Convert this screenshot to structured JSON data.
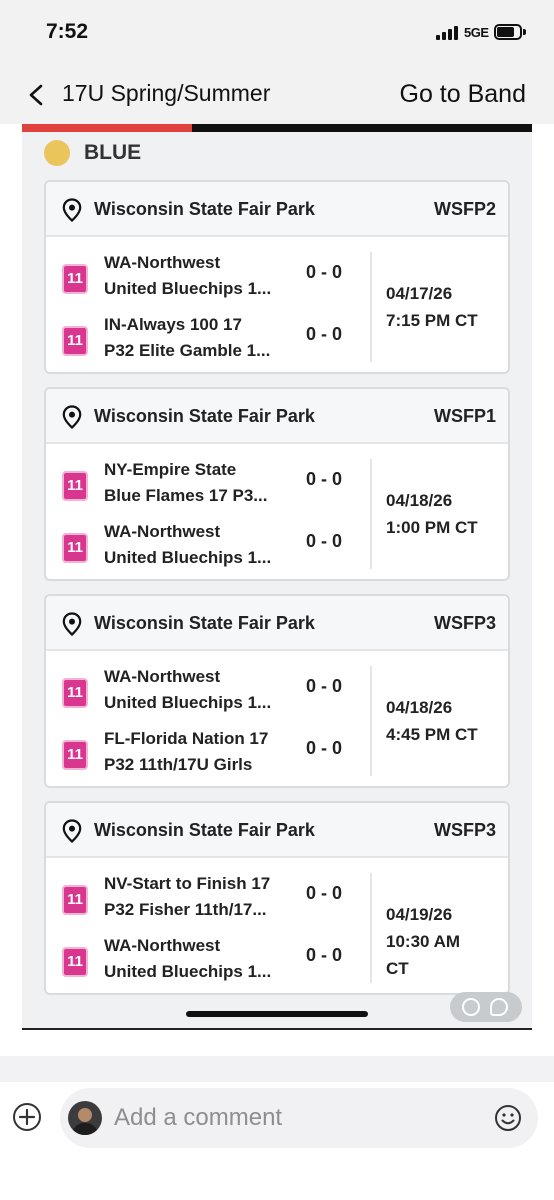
{
  "status_bar": {
    "time": "7:52",
    "network": "5GE"
  },
  "nav": {
    "title": "17U Spring/Summer",
    "action": "Go to Band"
  },
  "group": {
    "name": "BLUE",
    "dot_color": "#eac55c"
  },
  "games": [
    {
      "venue": "Wisconsin State Fair Park",
      "field": "WSFP2",
      "teams": [
        {
          "badge": "11",
          "name_line1": "WA-Northwest",
          "name_line2": "United Bluechips 1...",
          "score": "0 - 0"
        },
        {
          "badge": "11",
          "name_line1": "IN-Always 100 17",
          "name_line2": "P32 Elite Gamble 1...",
          "score": "0 - 0"
        }
      ],
      "date": "04/17/26",
      "time": "7:15 PM CT"
    },
    {
      "venue": "Wisconsin State Fair Park",
      "field": "WSFP1",
      "teams": [
        {
          "badge": "11",
          "name_line1": "NY-Empire State",
          "name_line2": "Blue Flames 17 P3...",
          "score": "0 - 0"
        },
        {
          "badge": "11",
          "name_line1": "WA-Northwest",
          "name_line2": "United Bluechips 1...",
          "score": "0 - 0"
        }
      ],
      "date": "04/18/26",
      "time": "1:00 PM CT"
    },
    {
      "venue": "Wisconsin State Fair Park",
      "field": "WSFP3",
      "teams": [
        {
          "badge": "11",
          "name_line1": "WA-Northwest",
          "name_line2": "United Bluechips 1...",
          "score": "0 - 0"
        },
        {
          "badge": "11",
          "name_line1": "FL-Florida Nation 17",
          "name_line2": "P32 11th/17U Girls",
          "score": "0 - 0"
        }
      ],
      "date": "04/18/26",
      "time": "4:45 PM CT"
    },
    {
      "venue": "Wisconsin State Fair Park",
      "field": "WSFP3",
      "teams": [
        {
          "badge": "11",
          "name_line1": "NV-Start to Finish 17",
          "name_line2": "P32 Fisher 11th/17...",
          "score": "0 - 0"
        },
        {
          "badge": "11",
          "name_line1": "WA-Northwest",
          "name_line2": "United Bluechips 1...",
          "score": "0 - 0"
        }
      ],
      "date": "04/19/26",
      "time": "10:30 AM",
      "time_line2": "CT"
    }
  ],
  "comment": {
    "placeholder": "Add a comment"
  },
  "colors": {
    "accent": "#e0433d",
    "badge": "#d9368f",
    "background": "#eff1f3"
  }
}
